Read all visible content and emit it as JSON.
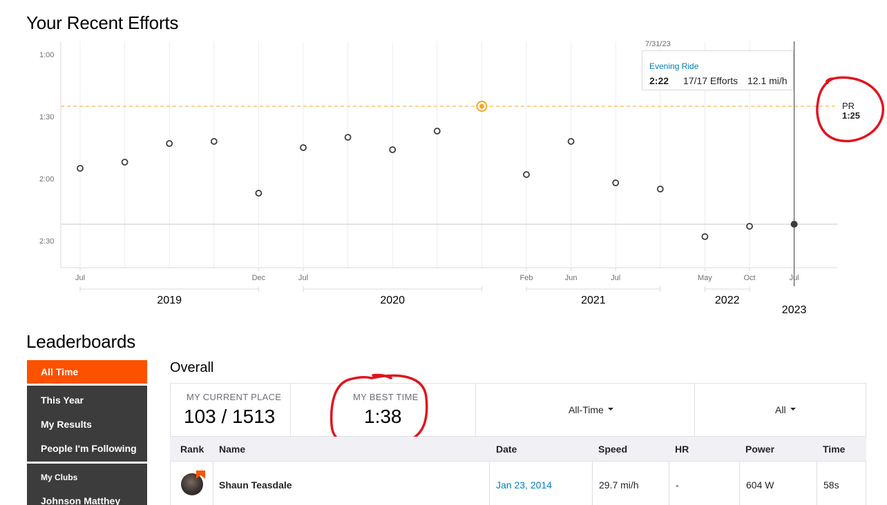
{
  "efforts": {
    "title": "Your Recent Efforts",
    "y_ticks": [
      "1:00",
      "1:30",
      "2:00",
      "2:30"
    ],
    "month_labels": [
      "Jul",
      "Dec",
      "Jul",
      "Feb",
      "Jun",
      "Jul",
      "May",
      "Oct",
      "Jul"
    ],
    "year_labels": [
      "2019",
      "2020",
      "2021",
      "2022",
      "2023"
    ],
    "tooltip": {
      "date": "7/31/23",
      "activity": "Evening Ride",
      "time": "2:22",
      "efforts": "17/17 Efforts",
      "speed": "12.1 mi/h"
    },
    "pr": {
      "label": "PR",
      "value": "1:25"
    },
    "colors": {
      "pr_line": "#f5a623",
      "point": "#3c3c3c",
      "grid": "#ededf0"
    }
  },
  "chart_data": {
    "type": "scatter",
    "title": "Your Recent Efforts",
    "ylabel": "",
    "xlabel": "",
    "y_unit": "seconds",
    "y_axis_reversed": true,
    "ylim": [
      "1:00",
      "2:40"
    ],
    "points": [
      {
        "x": 1,
        "y": "1:55"
      },
      {
        "x": 2,
        "y": "1:52"
      },
      {
        "x": 3,
        "y": "1:43"
      },
      {
        "x": 4,
        "y": "1:42"
      },
      {
        "x": 5,
        "y": "2:07"
      },
      {
        "x": 6,
        "y": "1:45"
      },
      {
        "x": 7,
        "y": "1:40"
      },
      {
        "x": 8,
        "y": "1:46"
      },
      {
        "x": 9,
        "y": "1:37"
      },
      {
        "x": 10,
        "y": "1:25",
        "pr": true
      },
      {
        "x": 11,
        "y": "1:58"
      },
      {
        "x": 12,
        "y": "1:42"
      },
      {
        "x": 13,
        "y": "2:02"
      },
      {
        "x": 14,
        "y": "2:05"
      },
      {
        "x": 15,
        "y": "2:28"
      },
      {
        "x": 16,
        "y": "2:23"
      },
      {
        "x": 17,
        "y": "2:22",
        "selected": true
      }
    ],
    "pr_line": "1:25",
    "grid": true
  },
  "leaderboards": {
    "title": "Leaderboards",
    "sidebar": {
      "active": "All Time",
      "items": [
        "This Year",
        "My Results",
        "People I'm Following"
      ],
      "clubs_header": "My Clubs",
      "clubs": [
        "Johnson Matthey"
      ]
    },
    "heading": "Overall",
    "stats": {
      "place_label": "MY CURRENT PLACE",
      "place_value": "103 / 1513",
      "best_label": "MY BEST TIME",
      "best_value": "1:38"
    },
    "filters": {
      "range": "All-Time",
      "group": "All"
    },
    "columns": [
      "Rank",
      "Name",
      "Date",
      "Speed",
      "HR",
      "Power",
      "Time"
    ],
    "rows": [
      {
        "name": "Shaun Teasdale",
        "date": "Jan 23, 2014",
        "speed": "29.7 mi/h",
        "hr": "-",
        "power": "604 W",
        "time": "58s"
      }
    ]
  }
}
